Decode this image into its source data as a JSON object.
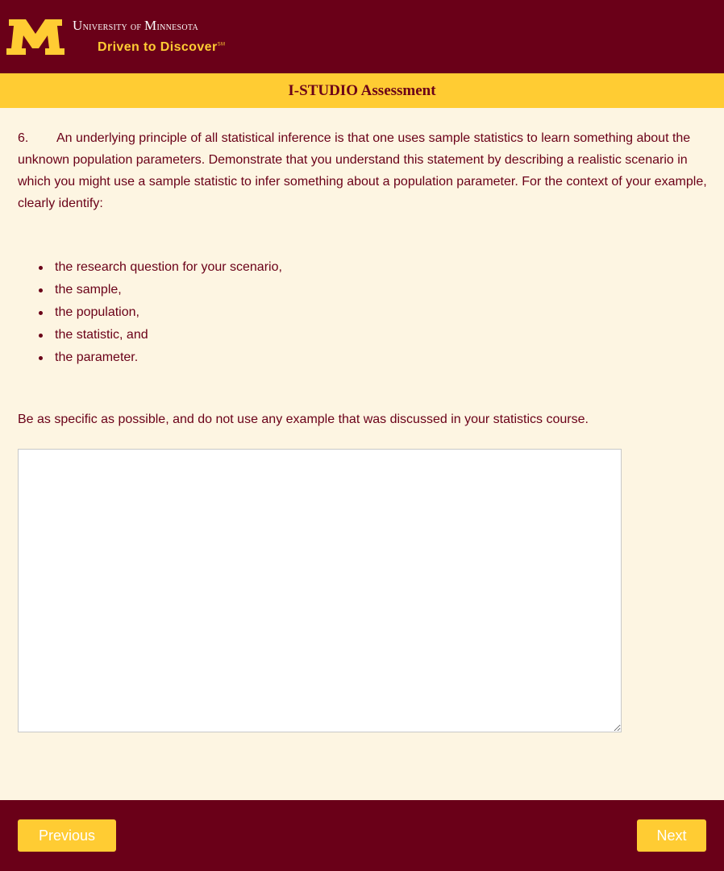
{
  "header": {
    "university_first": "U",
    "university_rest": "niversity of ",
    "university_second": "M",
    "university_rest2": "innesota",
    "tagline": "Driven to Discover",
    "tagline_mark": "SM"
  },
  "title_bar": {
    "title": "I-STUDIO Assessment"
  },
  "question": {
    "number": "6.",
    "text": "An underlying principle of all statistical inference is that one uses sample statistics to learn something about the unknown population parameters. Demonstrate that you understand this statement by describing a realistic scenario in which you might use a sample statistic to infer something about a population parameter. For the context of your example, clearly identify:",
    "bullets": [
      "the research question for your scenario,",
      "the sample,",
      "the population,",
      "the statistic, and",
      "the parameter."
    ],
    "instruction": "Be as specific as possible, and do not use any example that was discussed in your statistics course."
  },
  "answer": {
    "value": ""
  },
  "footer": {
    "previous_label": "Previous",
    "next_label": "Next"
  },
  "colors": {
    "maroon": "#6a0018",
    "gold": "#ffcc33",
    "background": "#fdf5e2"
  }
}
